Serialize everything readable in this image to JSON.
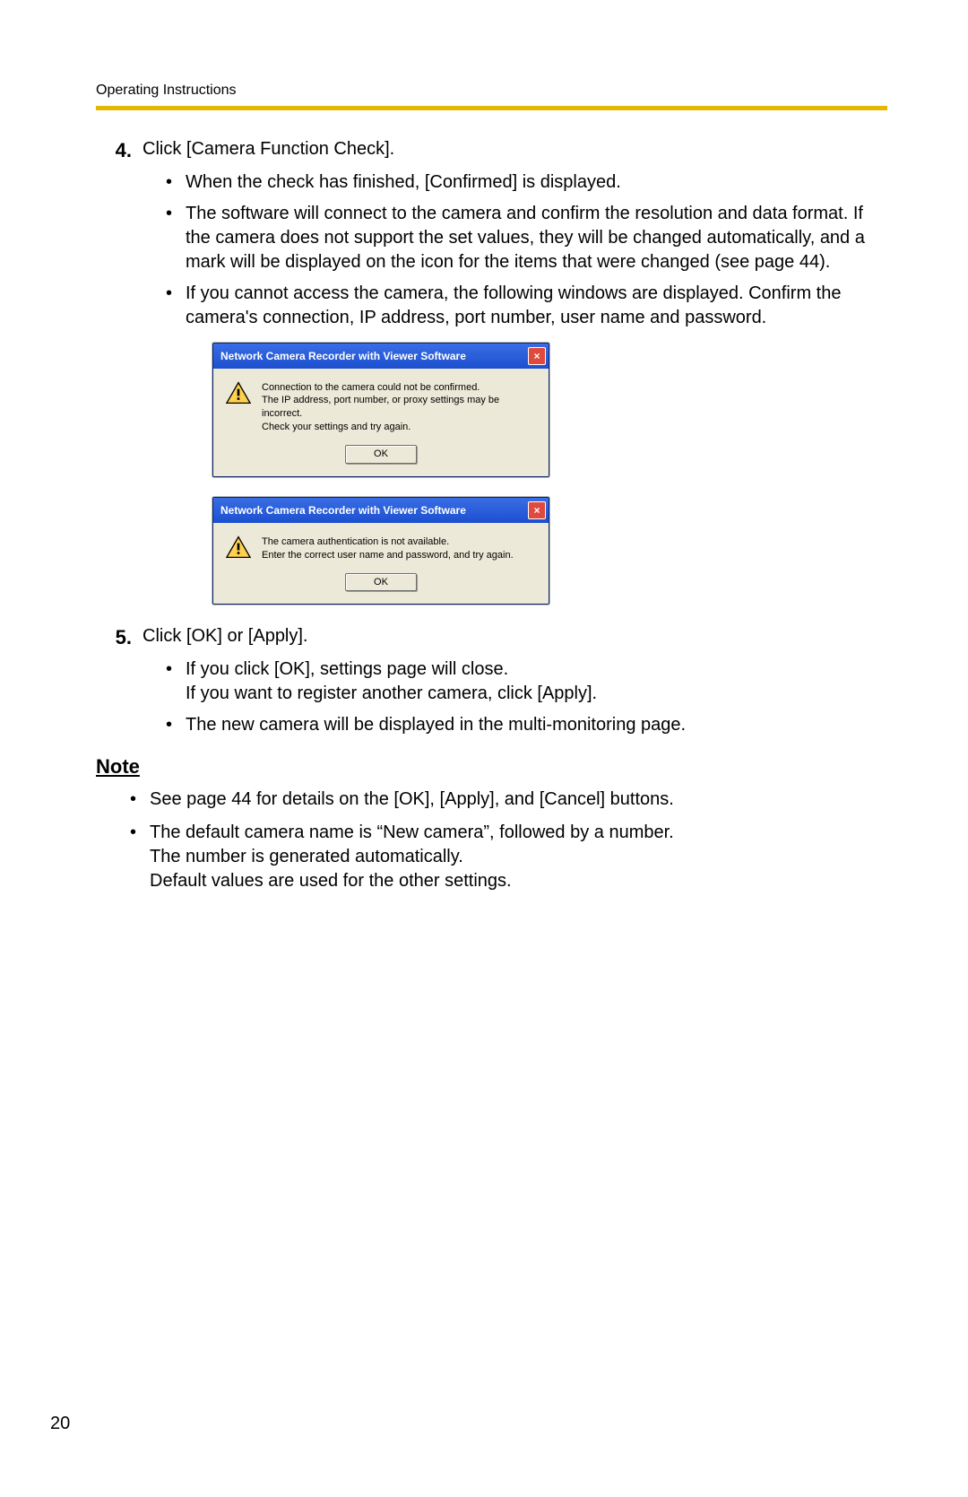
{
  "header": {
    "section": "Operating Instructions"
  },
  "page_number": "20",
  "step4": {
    "num": "4.",
    "lead": "Click [Camera Function Check].",
    "bullets": [
      "When the check has finished, [Confirmed] is displayed.",
      "The software will connect to the camera and confirm the resolution and data format. If the camera does not support the set values, they will be changed automatically, and a mark will be displayed on the icon for the items that were changed (see page 44).",
      "If you cannot access the camera, the following windows are displayed. Confirm the camera's connection, IP address, port number, user name and password."
    ]
  },
  "dialog1": {
    "title": "Network Camera Recorder with Viewer Software",
    "message": "Connection to the camera could not be confirmed.\nThe IP address, port number, or proxy settings may be incorrect.\nCheck your settings and try again.",
    "ok": "OK"
  },
  "dialog2": {
    "title": "Network Camera Recorder with Viewer Software",
    "message": "The camera authentication is not available.\nEnter the correct user name and password, and try again.",
    "ok": "OK"
  },
  "step5": {
    "num": "5.",
    "lead": "Click [OK] or [Apply].",
    "bullets": [
      "If you click [OK], settings page will close.\nIf you want to register another camera, click [Apply].",
      "The new camera will be displayed in the multi-monitoring page."
    ]
  },
  "note": {
    "heading": "Note",
    "bullets": [
      "See page 44 for details on the [OK], [Apply], and [Cancel] buttons.",
      "The default camera name is “New camera”, followed by a number.\nThe number is generated automatically.\nDefault values are used for the other settings."
    ]
  }
}
